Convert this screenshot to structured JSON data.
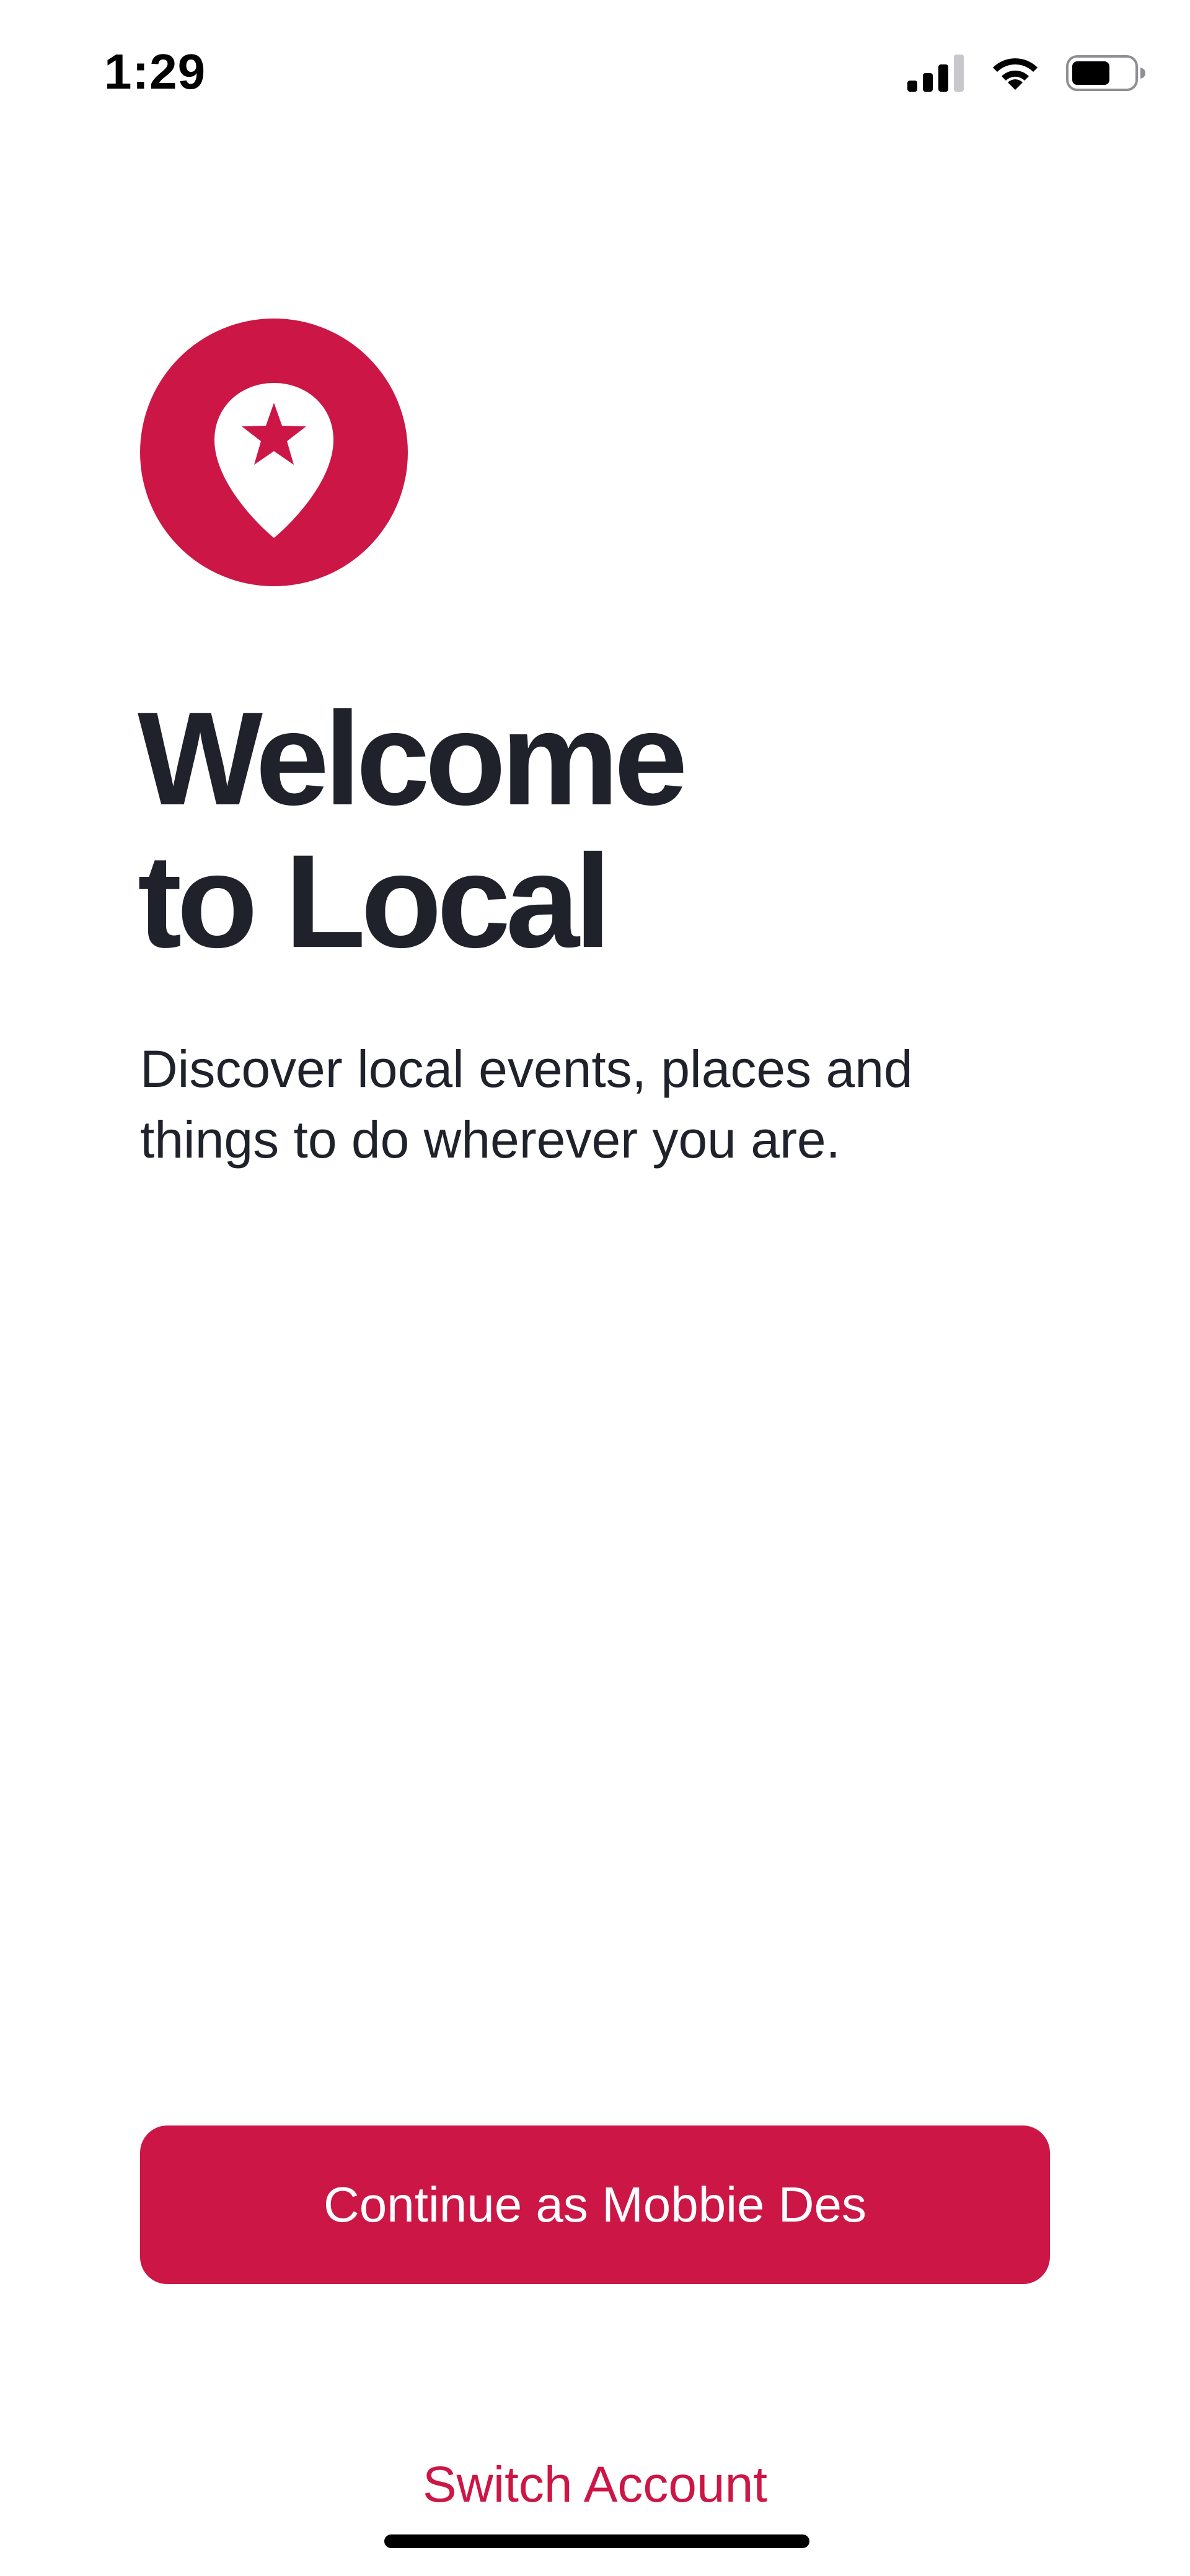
{
  "status_bar": {
    "time": "1:29",
    "icons": [
      "cellular-signal-icon",
      "wifi-icon",
      "battery-icon"
    ],
    "battery_level": 0.62
  },
  "logo": {
    "icon": "map-pin-star-icon",
    "color": "#cc1645"
  },
  "welcome": {
    "title_line_1": "Welcome",
    "title_line_2": "to Local",
    "subtitle_line_1": "Discover local events, places and",
    "subtitle_line_2": "things to do wherever you are."
  },
  "actions": {
    "continue_label": "Continue as Mobbie Des",
    "switch_account_label": "Switch Account"
  },
  "colors": {
    "accent": "#cc1645",
    "text": "#1f222b",
    "background": "#ffffff"
  }
}
